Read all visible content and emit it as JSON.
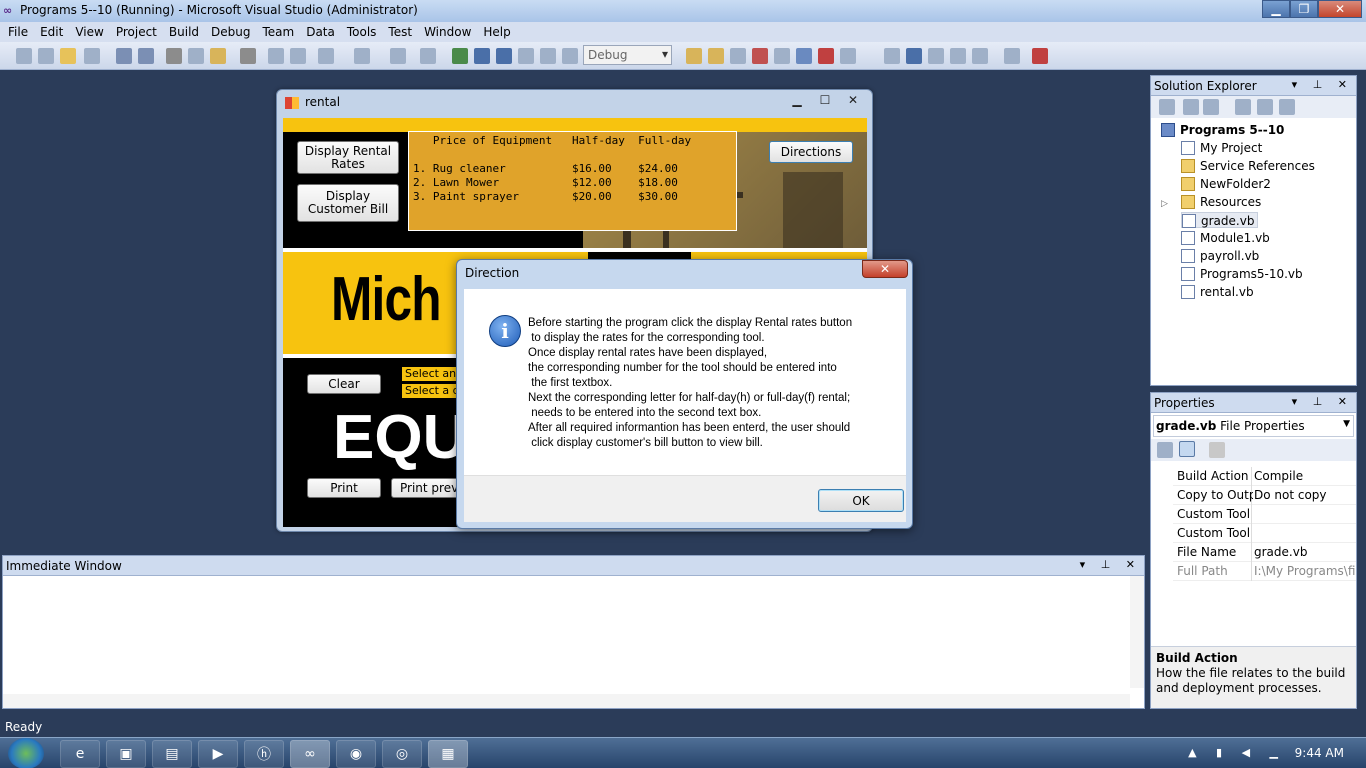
{
  "window": {
    "title": "Programs 5--10 (Running) - Microsoft Visual Studio (Administrator)"
  },
  "menu": [
    "File",
    "Edit",
    "View",
    "Project",
    "Build",
    "Debug",
    "Team",
    "Data",
    "Tools",
    "Test",
    "Window",
    "Help"
  ],
  "toolbar": {
    "config": "Debug"
  },
  "rental": {
    "title": "rental",
    "btn_rates": "Display Rental Rates",
    "btn_bill": "Display Customer Bill",
    "btn_directions": "Directions",
    "rates_text": "   Price of Equipment   Half-day  Full-day\n\n1. Rug cleaner          $16.00    $24.00\n2. Lawn Mower           $12.00    $18.00\n3. Paint sprayer        $20.00    $30.00",
    "banner": "Mich",
    "btn_clear": "Clear",
    "select1": "Select an",
    "select2": "Select a d",
    "eq": "EQU",
    "btn_print": "Print",
    "btn_preview": "Print preview"
  },
  "dialog": {
    "title": "Direction",
    "close_glyph": "✕",
    "message": "Before starting the program click the display Rental rates button\n to display the rates for the corresponding tool.\nOnce display rental rates have been displayed,\nthe corresponding number for the tool should be entered into\n the first textbox.\nNext the corresponding letter for half-day(h) or full-day(f) rental;\n needs to be entered into the second text box.\nAfter all required informantion has been enterd, the user should\n click display customer's bill button to view bill.",
    "ok": "OK"
  },
  "solution_explorer": {
    "title": "Solution Explorer",
    "root": "Programs 5--10",
    "items": [
      "My Project",
      "Service References",
      "NewFolder2",
      "Resources",
      "grade.vb",
      "Module1.vb",
      "payroll.vb",
      "Programs5-10.vb",
      "rental.vb"
    ]
  },
  "properties": {
    "title": "Properties",
    "object_name": "grade.vb",
    "object_type": "File Properties",
    "rows": [
      {
        "name": "Build Action",
        "value": "Compile"
      },
      {
        "name": "Copy to Outp",
        "value": "Do not copy"
      },
      {
        "name": "Custom Tool",
        "value": ""
      },
      {
        "name": "Custom Tool",
        "value": ""
      },
      {
        "name": "File Name",
        "value": "grade.vb"
      },
      {
        "name": "Full Path",
        "value": "I:\\My Programs\\fin"
      }
    ],
    "desc_title": "Build Action",
    "desc_text": "How the file relates to the build and deployment processes."
  },
  "immediate": {
    "title": "Immediate Window"
  },
  "status": {
    "text": "Ready"
  },
  "taskbar": {
    "clock": "9:44 AM"
  },
  "colors": {
    "accent": "#f7c30f",
    "rates_bg": "#e0a32a",
    "workspace": "#2b3c59"
  }
}
